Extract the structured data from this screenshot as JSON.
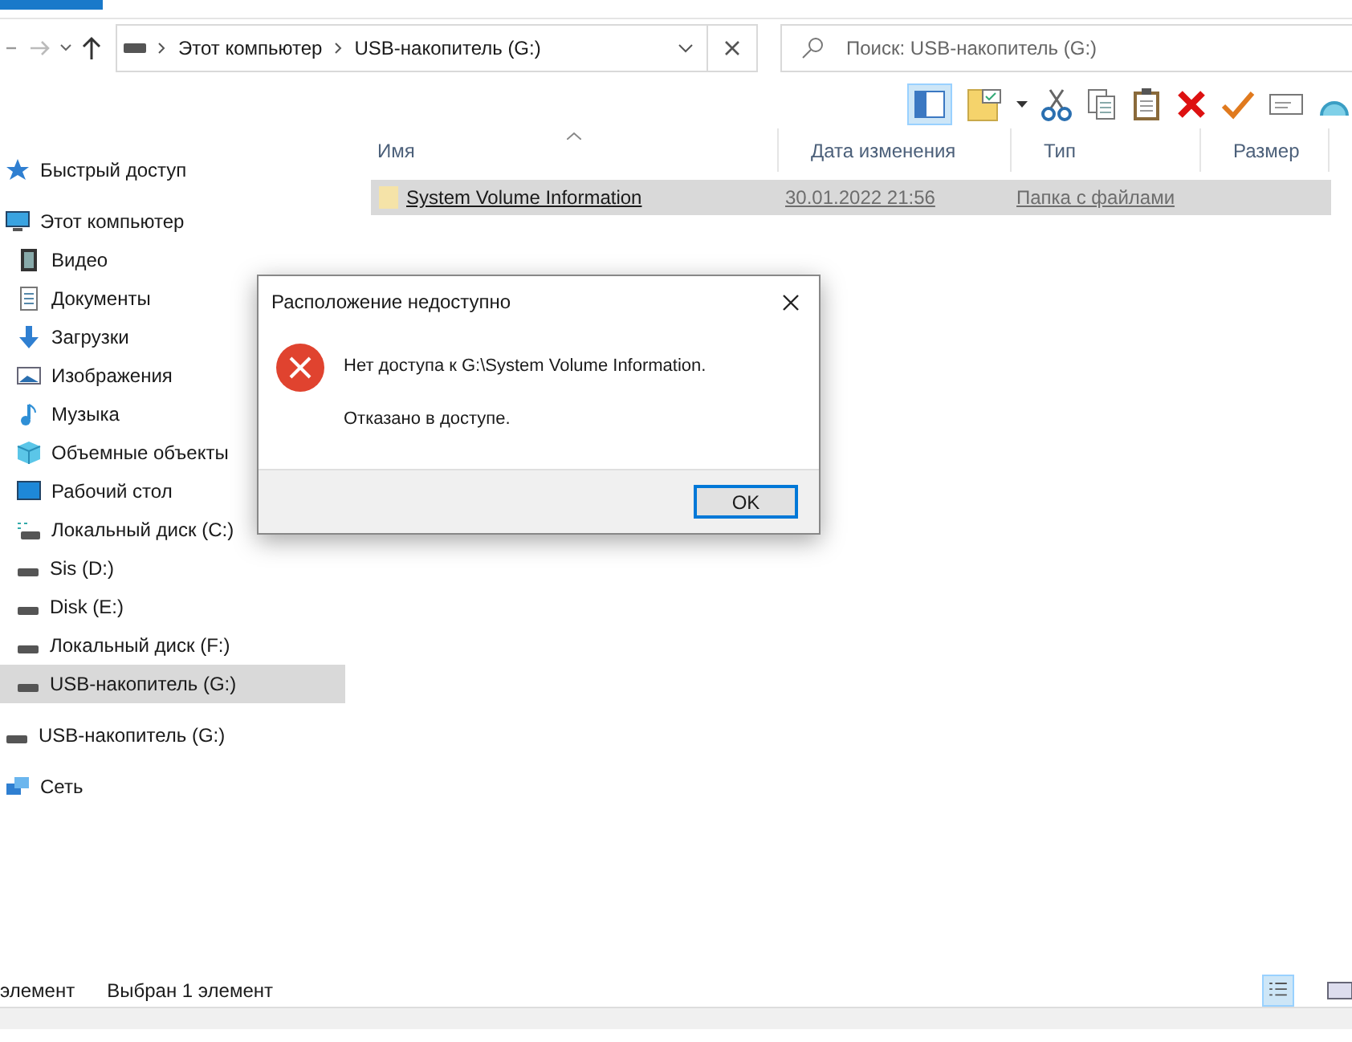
{
  "address": {
    "parts": [
      "Этот компьютер",
      "USB-накопитель (G:)"
    ]
  },
  "search": {
    "placeholder": "Поиск: USB-накопитель (G:)"
  },
  "sidebar": {
    "items": [
      {
        "label": "Быстрый доступ",
        "selected": false
      },
      {
        "label": "Этот компьютер",
        "selected": false,
        "children": [
          {
            "label": "Видео",
            "selected": false
          },
          {
            "label": "Документы",
            "selected": false
          },
          {
            "label": "Загрузки",
            "selected": false
          },
          {
            "label": "Изображения",
            "selected": false
          },
          {
            "label": "Музыка",
            "selected": false
          },
          {
            "label": "Объемные объекты",
            "selected": false
          },
          {
            "label": "Рабочий стол",
            "selected": false
          },
          {
            "label": "Локальный диск (C:)",
            "selected": false
          },
          {
            "label": "Sis (D:)",
            "selected": false
          },
          {
            "label": "Disk (E:)",
            "selected": false
          },
          {
            "label": "Локальный диск (F:)",
            "selected": false
          },
          {
            "label": "USB-накопитель (G:)",
            "selected": true
          }
        ]
      },
      {
        "label": "USB-накопитель (G:)",
        "selected": false
      },
      {
        "label": "Сеть",
        "selected": false
      }
    ]
  },
  "table": {
    "columns": [
      "Имя",
      "Дата изменения",
      "Тип",
      "Размер"
    ],
    "rows": [
      {
        "name": "System Volume Information",
        "date": "30.01.2022 21:56",
        "type": "Папка с файлами",
        "selected": true
      }
    ]
  },
  "dialog": {
    "title": "Расположение недоступно",
    "message": "Нет доступа к G:\\System Volume Information.",
    "detail": "Отказано в доступе.",
    "button": "OK"
  },
  "status_bar": {
    "count": "элемент",
    "selection": "Выбран 1 элемент"
  }
}
